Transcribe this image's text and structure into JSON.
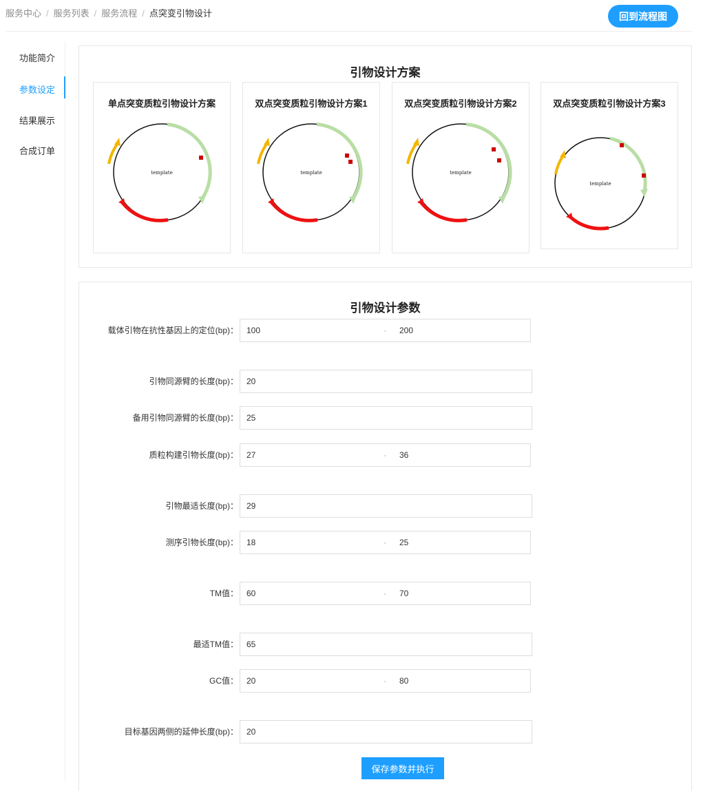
{
  "breadcrumb": {
    "items": [
      "服务中心",
      "服务列表",
      "服务流程"
    ],
    "separator": "/",
    "current": "点突变引物设计"
  },
  "header": {
    "back_label": "回到流程图"
  },
  "sidebar": {
    "items": [
      {
        "label": "功能简介",
        "active": false
      },
      {
        "label": "参数设定",
        "active": true
      },
      {
        "label": "结果展示",
        "active": false
      },
      {
        "label": "合成订单",
        "active": false
      }
    ]
  },
  "schemes": {
    "title": "引物设计方案",
    "cards": [
      {
        "title": "单点突变质粒引物设计方案",
        "template": "template"
      },
      {
        "title": "双点突变质粒引物设计方案1",
        "template": "template"
      },
      {
        "title": "双点突变质粒引物设计方案2",
        "template": "template"
      },
      {
        "title": "双点突变质粒引物设计方案3",
        "template": "template"
      }
    ]
  },
  "params": {
    "title": "引物设计参数",
    "rows": [
      {
        "label": "载体引物在抗性基因上的定位(bp)：",
        "min": "100",
        "max": "200"
      },
      {
        "label": "引物同源臂的长度(bp)：",
        "value": "20"
      },
      {
        "label": "备用引物同源臂的长度(bp)：",
        "value": "25"
      },
      {
        "label": "质粒构建引物长度(bp)：",
        "min": "27",
        "max": "36"
      },
      {
        "label": "引物最适长度(bp)：",
        "value": "29"
      },
      {
        "label": "测序引物长度(bp)：",
        "min": "18",
        "max": "25"
      },
      {
        "label": "TM值：",
        "min": "60",
        "max": "70"
      },
      {
        "label": "最适TM值：",
        "value": "65"
      },
      {
        "label": "GC值：",
        "min": "20",
        "max": "80"
      },
      {
        "label": "目标基因两侧的延伸长度(bp)：",
        "value": "20"
      }
    ],
    "range_separator": "-",
    "save_label": "保存参数并执行"
  },
  "colors": {
    "accent": "#1e9fff",
    "plasmid_green": "#b9dea5",
    "plasmid_red": "#ee1111",
    "plasmid_yellow": "#f2b600",
    "mutation": "#cc0000"
  }
}
